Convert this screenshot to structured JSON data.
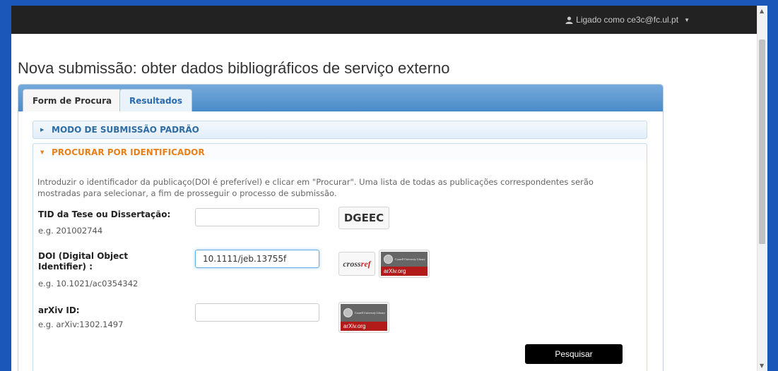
{
  "navbar": {
    "user_label": "Ligado como ce3c@fc.ul.pt"
  },
  "page": {
    "title": "Nova submissão: obter dados bibliográficos de serviço externo"
  },
  "tabs": [
    {
      "label": "Form de Procura",
      "active": true
    },
    {
      "label": "Resultados",
      "active": false
    }
  ],
  "sections": {
    "default_mode": {
      "label": "MODO DE SUBMISSÃO PADRÃO",
      "expanded": false
    },
    "by_identifier": {
      "label": "PROCURAR POR IDENTIFICADOR",
      "expanded": true
    }
  },
  "form": {
    "intro": "Introduzir o identificador da publicaço(DOI é preferível) e clicar em \"Procurar\". Uma lista de todas as publicações correspondentes serão mostradas para selecionar, a fim de prosseguir o processo de submissão.",
    "tid": {
      "label": "TID da Tese ou Dissertação:",
      "example": "e.g. 201002744",
      "value": ""
    },
    "doi": {
      "label": "DOI (Digital Object Identifier) :",
      "example": "e.g. 10.1021/ac0354342",
      "value": "10.1111/jeb.13755f"
    },
    "arxiv": {
      "label": "arXiv ID:",
      "example": "e.g. arXiv:1302.1497",
      "value": ""
    },
    "search_button": "Pesquisar"
  },
  "logos": {
    "dgeec": "DGEEC",
    "crossref_prefix": "cross",
    "crossref_suffix": "ref",
    "arxiv_library": "Cornell University Library",
    "arxiv_site": "arXiv.org"
  },
  "colors": {
    "accent_blue": "#2e6da4",
    "open_section": "#e8801a",
    "navbar": "#222222",
    "arxiv_red": "#b31b1b"
  },
  "icons": {
    "user": "person-icon",
    "caret": "caret-down-icon",
    "collapsed": "triangle-right-icon",
    "expanded": "triangle-down-icon"
  }
}
